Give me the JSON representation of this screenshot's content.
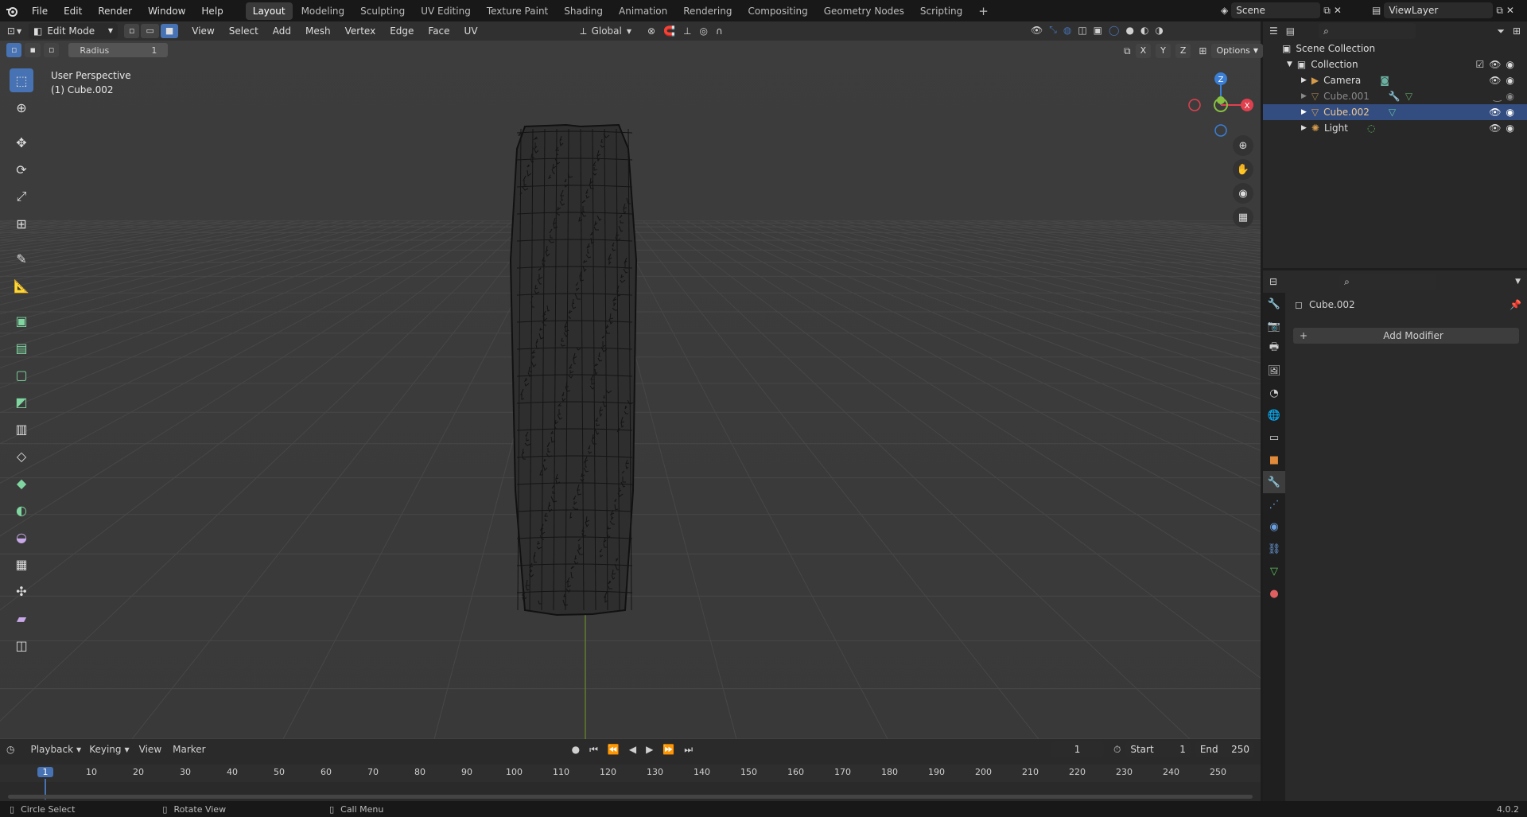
{
  "app": {
    "menu": [
      "File",
      "Edit",
      "Render",
      "Window",
      "Help"
    ],
    "workspaces": [
      "Layout",
      "Modeling",
      "Sculpting",
      "UV Editing",
      "Texture Paint",
      "Shading",
      "Animation",
      "Rendering",
      "Compositing",
      "Geometry Nodes",
      "Scripting"
    ],
    "active_workspace": "Layout",
    "add_workspace": "+",
    "scene": "Scene",
    "view_layer": "ViewLayer"
  },
  "viewport": {
    "mode": "Edit Mode",
    "header_menu": [
      "View",
      "Select",
      "Add",
      "Mesh",
      "Vertex",
      "Edge",
      "Face",
      "UV"
    ],
    "orientation": "Global",
    "options_label": "Options",
    "axis_buttons": [
      "X",
      "Y",
      "Z"
    ],
    "radius_label": "Radius",
    "radius_value": "1",
    "overlay_line1": "User Perspective",
    "overlay_line2": "(1) Cube.002",
    "gizmo": {
      "z": "Z",
      "x": "X"
    },
    "tools": [
      "select-box",
      "cursor",
      "move",
      "rotate",
      "scale",
      "transform",
      "annotate",
      "measure",
      "add-cube",
      "extrude",
      "inset",
      "bevel",
      "loop-cut",
      "knife",
      "poly-build",
      "spin",
      "smooth",
      "edge-slide",
      "shrink-fatten",
      "shear",
      "rip"
    ]
  },
  "outliner": {
    "root": "Scene Collection",
    "collection": "Collection",
    "items": [
      {
        "label": "Camera",
        "icon": "camera-icon",
        "color": "#d59b4b",
        "selected": false,
        "dim": false
      },
      {
        "label": "Cube.001",
        "icon": "mesh-icon",
        "color": "#d59b4b",
        "selected": false,
        "dim": true
      },
      {
        "label": "Cube.002",
        "icon": "mesh-icon",
        "color": "#d59b4b",
        "selected": true,
        "dim": false
      },
      {
        "label": "Light",
        "icon": "light-icon",
        "color": "#d59b4b",
        "selected": false,
        "dim": false
      }
    ]
  },
  "properties": {
    "object_name": "Cube.002",
    "add_modifier": "Add Modifier"
  },
  "timeline": {
    "menu": [
      "Playback",
      "Keying",
      "View",
      "Marker"
    ],
    "current_frame": "1",
    "start_label": "Start",
    "start_value": "1",
    "end_label": "End",
    "end_value": "250",
    "ruler": [
      "1",
      "10",
      "20",
      "30",
      "40",
      "50",
      "60",
      "70",
      "80",
      "90",
      "100",
      "110",
      "120",
      "130",
      "140",
      "150",
      "160",
      "170",
      "180",
      "190",
      "200",
      "210",
      "220",
      "230",
      "240",
      "250"
    ]
  },
  "statusbar": {
    "left": "Circle Select",
    "middle": "Rotate View",
    "right": "Call Menu",
    "version": "4.0.2"
  },
  "colors": {
    "accent": "#4772b3",
    "selection_row": "#334d80",
    "axis_x": "#e0404e",
    "axis_y": "#88c040",
    "axis_z": "#3b7fd6"
  }
}
